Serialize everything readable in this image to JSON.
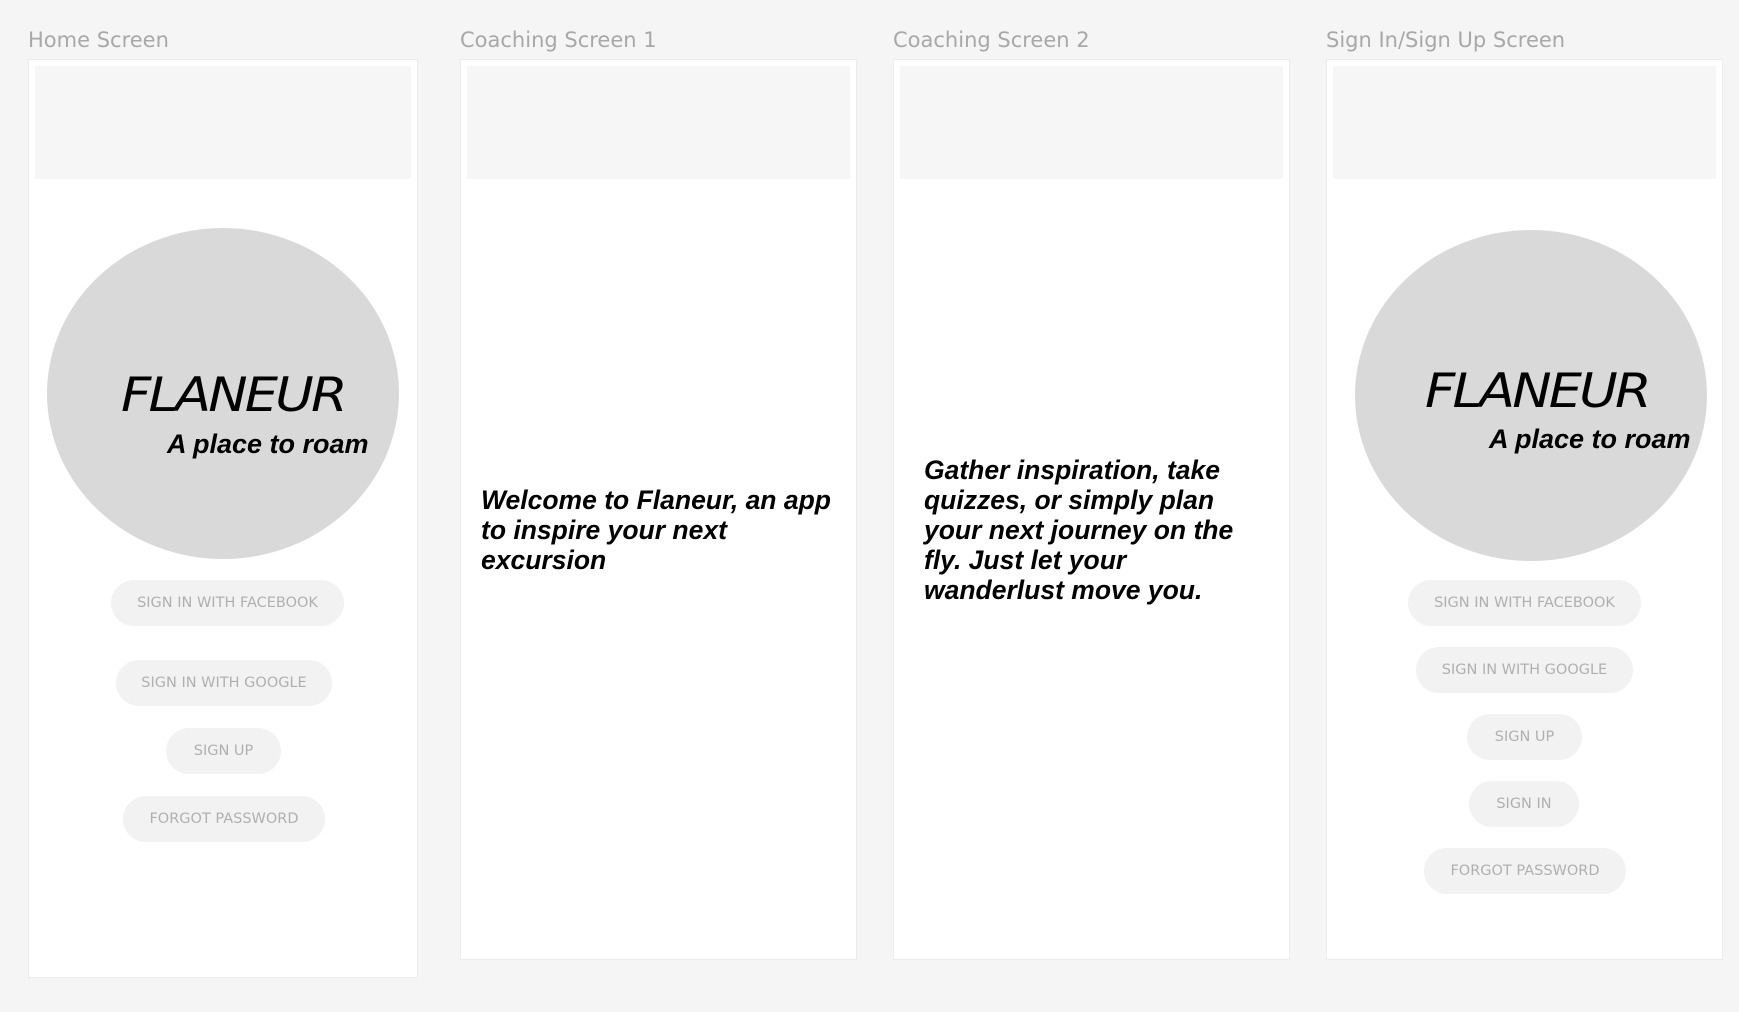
{
  "frames": {
    "home": {
      "label": "Home Screen",
      "logo_title": "FLANEUR",
      "logo_tagline": "A place to roam",
      "buttons": {
        "facebook": "SIGN IN WITH FACEBOOK",
        "google": "SIGN IN WITH GOOGLE",
        "signup": "SIGN UP",
        "forgot": "FORGOT PASSWORD"
      }
    },
    "coaching1": {
      "label": "Coaching Screen 1",
      "text": "Welcome to Flaneur, an app to inspire your next excursion"
    },
    "coaching2": {
      "label": "Coaching Screen 2",
      "text": "Gather inspiration, take quizzes, or simply plan your next journey on the fly. Just let your wanderlust move you."
    },
    "signin": {
      "label": "Sign In/Sign Up Screen",
      "logo_title": "FLANEUR",
      "logo_tagline": "A place to roam",
      "buttons": {
        "facebook": "SIGN IN WITH FACEBOOK",
        "google": "SIGN IN WITH GOOGLE",
        "signup": "SIGN UP",
        "signin": "SIGN IN",
        "forgot": "FORGOT PASSWORD"
      }
    }
  },
  "colors": {
    "canvas": "#f5f5f5",
    "frame": "#ffffff",
    "status_bar": "#f6f6f6",
    "logo_circle": "#d9d9d9",
    "button_bg": "#f2f2f2",
    "button_text": "#b0b0b0",
    "label_text": "#a8a8a8"
  }
}
